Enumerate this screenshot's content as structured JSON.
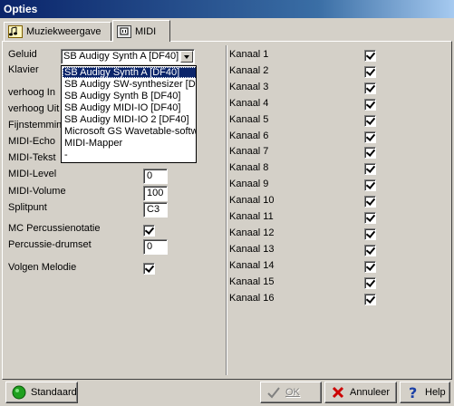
{
  "window": {
    "title": "Opties"
  },
  "tabs": [
    {
      "label": "Muziekweergave",
      "icon": "music-notes-icon"
    },
    {
      "label": "MIDI",
      "icon": "midi-connector-icon"
    }
  ],
  "left": {
    "geluid_label": "Geluid",
    "geluid_value": "SB Audigy Synth A [DF40]",
    "klavier_label": "Klavier",
    "verhoog_in_label": "verhoog In",
    "verhoog_uit_label": "verhoog Uit",
    "fijnstemming_label": "Fijnstemming",
    "midi_echo_label": "MIDI-Echo",
    "midi_tekst_label": "MIDI-Tekst",
    "midi_level_label": "MIDI-Level",
    "midi_level_value": "0",
    "midi_volume_label": "MIDI-Volume",
    "midi_volume_value": "100",
    "splitpunt_label": "Splitpunt",
    "splitpunt_value": "C3",
    "mc_perc_label": "MC Percussienotatie",
    "perc_drumset_label": "Percussie-drumset",
    "perc_drumset_value": "0",
    "volgen_label": "Volgen Melodie"
  },
  "dropdown": {
    "options": [
      "SB Audigy Synth A [DF40]",
      "SB Audigy SW-synthesizer [DF",
      "SB Audigy Synth B [DF40]",
      "SB Audigy MIDI-IO [DF40]",
      "SB Audigy MIDI-IO 2 [DF40]",
      "Microsoft GS Wavetable-softwa",
      "MIDI-Mapper",
      "-"
    ],
    "selected_index": 0
  },
  "channels": [
    "Kanaal 1",
    "Kanaal 2",
    "Kanaal 3",
    "Kanaal 4",
    "Kanaal 5",
    "Kanaal 6",
    "Kanaal 7",
    "Kanaal 8",
    "Kanaal 9",
    "Kanaal 10",
    "Kanaal 11",
    "Kanaal 12",
    "Kanaal 13",
    "Kanaal 14",
    "Kanaal 15",
    "Kanaal 16"
  ],
  "buttons": {
    "standaard": "Standaard",
    "ok": "OK",
    "annuleer": "Annuleer",
    "help": "Help"
  },
  "colors": {
    "title_bar": "#0a246a",
    "selection": "#0a246a",
    "face": "#d4d0c8",
    "standaard_icon": "#1fa01f",
    "cancel_icon": "#cc0000",
    "help_icon": "#1a3fa6"
  }
}
